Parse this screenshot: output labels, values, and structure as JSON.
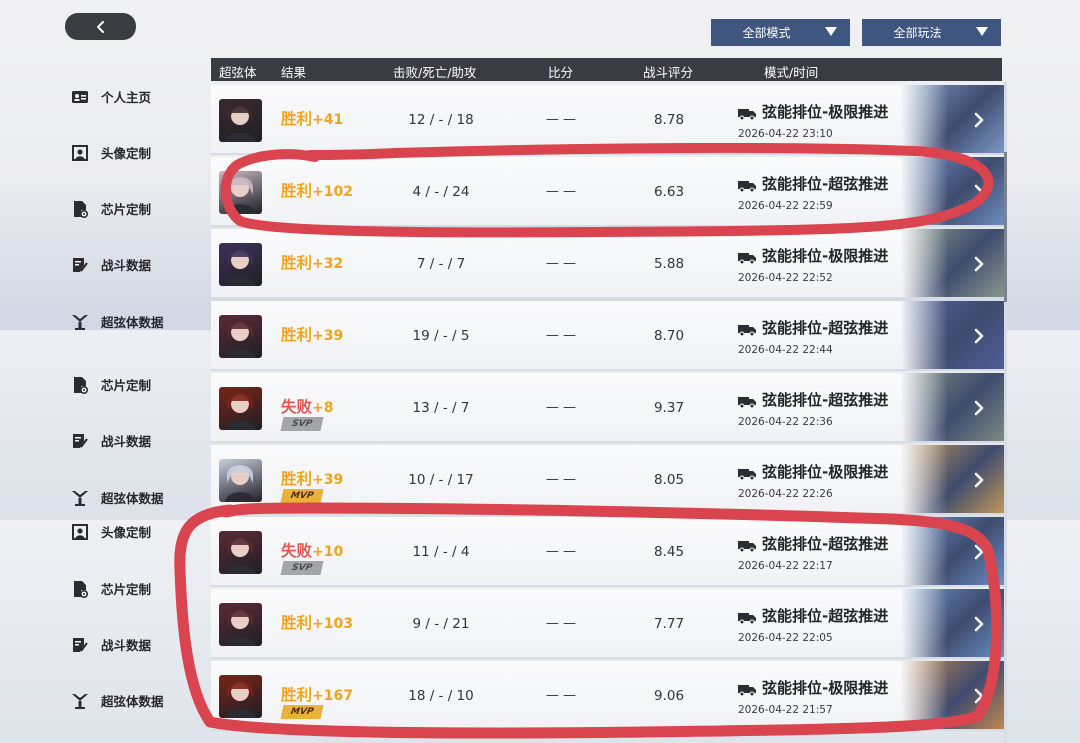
{
  "header": {
    "filters": [
      {
        "label": "全部模式"
      },
      {
        "label": "全部玩法"
      }
    ]
  },
  "sidebar": {
    "items": [
      {
        "label": "个人主页",
        "icon": "profile-card-icon"
      },
      {
        "label": "头像定制",
        "icon": "avatar-frame-icon"
      },
      {
        "label": "芯片定制",
        "icon": "chip-gear-icon"
      },
      {
        "label": "战斗数据",
        "icon": "battle-data-icon"
      },
      {
        "label": "超弦体数据",
        "icon": "character-data-icon"
      },
      {
        "label": "芯片定制",
        "icon": "chip-gear-icon"
      },
      {
        "label": "战斗数据",
        "icon": "battle-data-icon"
      },
      {
        "label": "超弦体数据",
        "icon": "character-data-icon"
      },
      {
        "label": "头像定制",
        "icon": "avatar-frame-icon"
      },
      {
        "label": "芯片定制",
        "icon": "chip-gear-icon"
      },
      {
        "label": "战斗数据",
        "icon": "battle-data-icon"
      },
      {
        "label": "超弦体数据",
        "icon": "character-data-icon"
      }
    ]
  },
  "table": {
    "columns": [
      "超弦体",
      "结果",
      "击败/死亡/助攻",
      "比分",
      "战斗评分",
      "模式/时间"
    ],
    "rows": [
      {
        "result": "胜利",
        "delta": "+41",
        "win": true,
        "badge": "",
        "kda": "12 / - / 18",
        "score": "— —",
        "rating": "8.78",
        "mode": "弦能排位-极限推进",
        "time": "2026-04-22 23:10",
        "avatar_color": "#3a2a2e",
        "thumb_color": "#7e9cc6"
      },
      {
        "result": "胜利",
        "delta": "+102",
        "win": true,
        "badge": "",
        "kda": "4 / - / 24",
        "score": "— —",
        "rating": "6.63",
        "mode": "弦能排位-超弦推进",
        "time": "2026-04-22 22:59",
        "avatar_color": "#c9b7c3",
        "thumb_color": "#6f8fc2"
      },
      {
        "result": "胜利",
        "delta": "+32",
        "win": true,
        "badge": "",
        "kda": "7 / - / 7",
        "score": "— —",
        "rating": "5.88",
        "mode": "弦能排位-极限推进",
        "time": "2026-04-22 22:52",
        "avatar_color": "#3e3156",
        "thumb_color": "#8a9a8c"
      },
      {
        "result": "胜利",
        "delta": "+39",
        "win": true,
        "badge": "",
        "kda": "19 / - / 5",
        "score": "— —",
        "rating": "8.70",
        "mode": "弦能排位-超弦推进",
        "time": "2026-04-22 22:44",
        "avatar_color": "#5a2a36",
        "thumb_color": "#4f5f9a"
      },
      {
        "result": "失败",
        "delta": "+8",
        "win": false,
        "badge": "SVP",
        "kda": "13 / - / 7",
        "score": "— —",
        "rating": "9.37",
        "mode": "弦能排位-超弦推进",
        "time": "2026-04-22 22:36",
        "avatar_color": "#7a2418",
        "thumb_color": "#7f8e84"
      },
      {
        "result": "胜利",
        "delta": "+39",
        "win": true,
        "badge": "MVP",
        "kda": "10 / - / 17",
        "score": "— —",
        "rating": "8.05",
        "mode": "弦能排位-极限推进",
        "time": "2026-04-22 22:26",
        "avatar_color": "#c9cfdf",
        "thumb_color": "#c69a5a"
      },
      {
        "result": "失败",
        "delta": "+10",
        "win": false,
        "badge": "SVP",
        "kda": "11 / - / 4",
        "score": "— —",
        "rating": "8.45",
        "mode": "弦能排位-超弦推进",
        "time": "2026-04-22 22:17",
        "avatar_color": "#5a2a36",
        "thumb_color": "#6c93c9"
      },
      {
        "result": "胜利",
        "delta": "+103",
        "win": true,
        "badge": "",
        "kda": "9 / - / 21",
        "score": "— —",
        "rating": "7.77",
        "mode": "弦能排位-超弦推进",
        "time": "2026-04-22 22:05",
        "avatar_color": "#5a2a36",
        "thumb_color": "#6c93c9"
      },
      {
        "result": "胜利",
        "delta": "+167",
        "win": true,
        "badge": "MVP",
        "kda": "18 / - / 10",
        "score": "— —",
        "rating": "9.06",
        "mode": "弦能排位-极限推进",
        "time": "2026-04-22 21:57",
        "avatar_color": "#7a2418",
        "thumb_color": "#c6884f"
      }
    ]
  },
  "colors": {
    "win": "#f0a41d",
    "loss": "#e05a4f",
    "header_bg": "#3a3c44",
    "filter_bg": "#3f5681",
    "marker": "#d9444e"
  }
}
